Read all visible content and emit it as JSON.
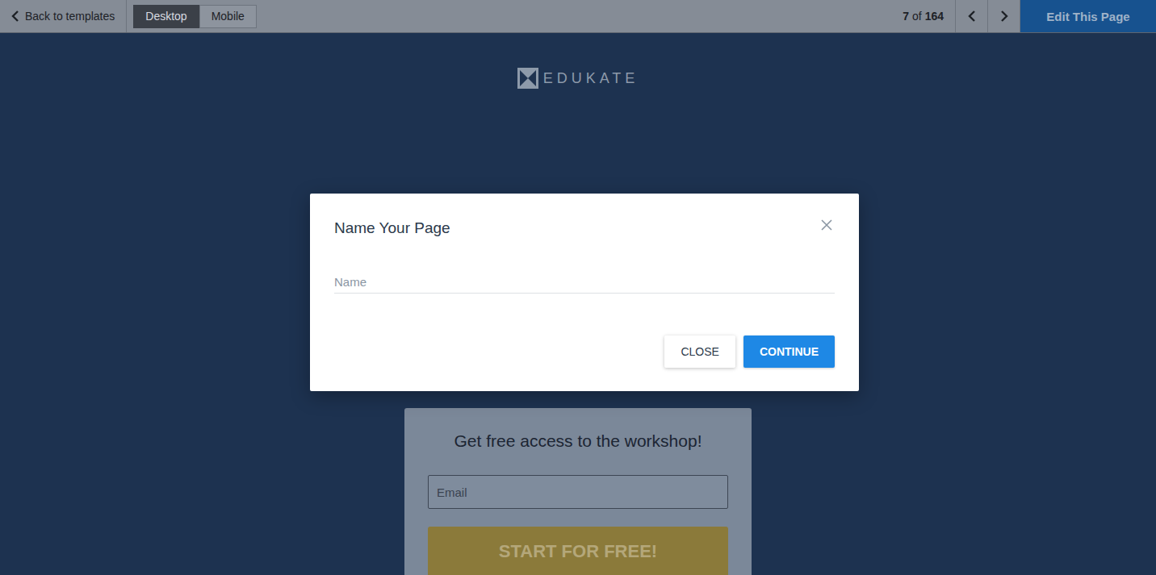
{
  "topbar": {
    "back": "Back to templates",
    "views": [
      {
        "label": "Desktop",
        "selected": true
      },
      {
        "label": "Mobile",
        "selected": false
      }
    ],
    "counter_current": "7",
    "counter_of": "of",
    "counter_total": "164",
    "edit": "Edit This Page"
  },
  "logo": "EDUKATE",
  "form": {
    "title": "Get free access to the workshop!",
    "placeholder": "Email",
    "button": "START FOR FREE!"
  },
  "modal": {
    "title": "Name Your Page",
    "field": {
      "placeholder": "Name"
    },
    "buttons": [
      {
        "label": "CLOSE",
        "kind": "secondary"
      },
      {
        "label": "CONTINUE",
        "kind": "primary"
      }
    ]
  }
}
